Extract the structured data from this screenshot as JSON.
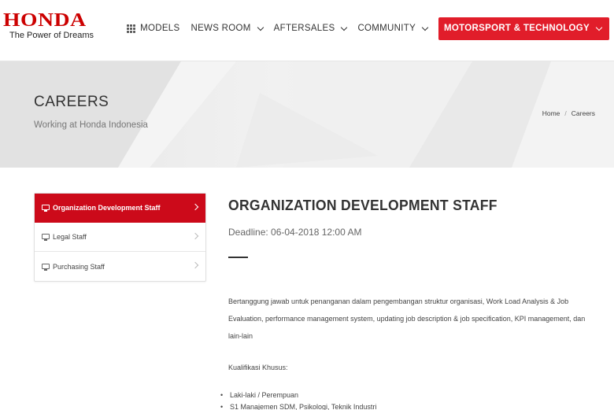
{
  "brand": {
    "name": "HONDA",
    "tagline": "The Power of Dreams"
  },
  "nav": {
    "models": "MODELS",
    "newsroom": "NEWS ROOM",
    "aftersales": "AFTERSALES",
    "community": "COMMUNITY",
    "motorsport": "MOTORSPORT & TECHNOLOGY"
  },
  "banner": {
    "title": "CAREERS",
    "subtitle": "Working at Honda Indonesia",
    "breadcrumb": [
      "Home",
      "Careers"
    ]
  },
  "sidebar": {
    "items": [
      {
        "label": "Organization Development Staff",
        "active": true
      },
      {
        "label": "Legal Staff",
        "active": false
      },
      {
        "label": "Purchasing Staff",
        "active": false
      }
    ]
  },
  "job": {
    "title": "ORGANIZATION DEVELOPMENT STAFF",
    "deadline": "Deadline: 06-04-2018 12:00 AM",
    "description": "Bertanggung jawab untuk penanganan dalam pengembangan struktur organisasi, Work Load Analysis & Job Evaluation, performance management system, updating job description & job specification, KPI management, dan lain-lain",
    "qualification_heading": "Kualifikasi Khusus:",
    "qualifications": [
      "Laki-laki / Perempuan",
      "S1 Manajemen SDM, Psikologi, Teknik Industri"
    ]
  },
  "colors": {
    "brand_red": "#cc0000",
    "accent_red": "#e11d2a",
    "active_red": "#cc0a1a"
  }
}
